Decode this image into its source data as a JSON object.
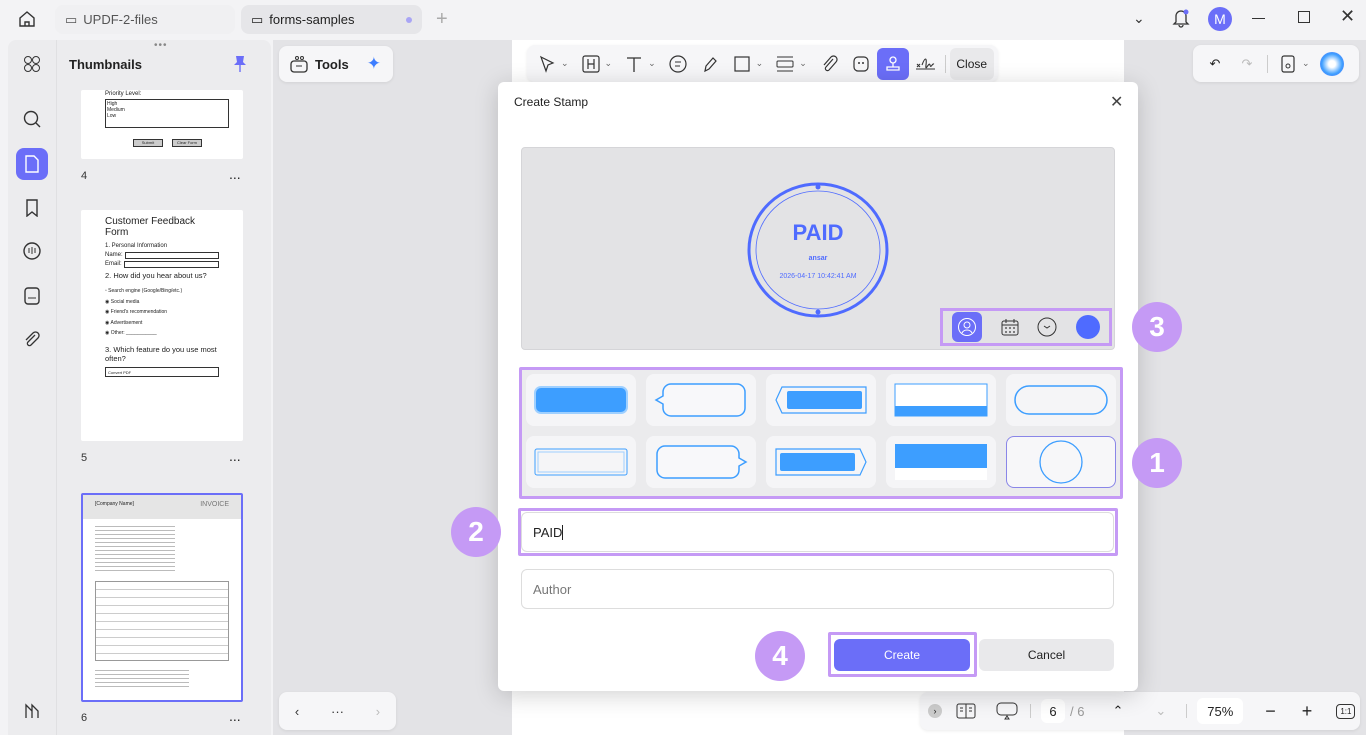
{
  "tabs": [
    {
      "label": "UPDF-2-files",
      "active": false
    },
    {
      "label": "forms-samples",
      "active": true,
      "unsaved_dot": true
    }
  ],
  "window_icons": [
    "chevron-down-icon",
    "bell-icon",
    "avatar",
    "restore-icon",
    "close-icon"
  ],
  "avatar_letter": "M",
  "thumbnails": {
    "title": "Thumbnails",
    "pages": [
      {
        "number": "4",
        "form_label": "Priority Level:",
        "options": [
          "High",
          "Medium",
          "Low"
        ],
        "buttons": [
          "Submit",
          "Clear Form"
        ]
      },
      {
        "number": "5",
        "title": "Customer Feedback Form",
        "section1": "1. Personal Information",
        "name_label": "Name:",
        "email_label": "Email:",
        "section2": "2. How did you hear about us?",
        "choices": [
          "Search engine (Google/Bing/etc.)",
          "Social media",
          "Friend's recommendation",
          "Advertisement",
          "Other: ___________"
        ],
        "section3": "3. Which feature do you use most often?",
        "select_value": "Convert PDF"
      },
      {
        "number": "6",
        "company": "[Company Name]",
        "doc_title": "INVOICE",
        "selected": true
      }
    ],
    "more": "..."
  },
  "tools": {
    "label": "Tools"
  },
  "toolbar": {
    "close_label": "Close",
    "active_tool": "stamp"
  },
  "dialog": {
    "title": "Create Stamp",
    "preview": {
      "text": "PAID",
      "author": "ansar",
      "datetime": "2026-04-17 10:42:41 AM",
      "color": "#4f6bff"
    },
    "options": [
      "user-icon",
      "calendar-icon",
      "clock-icon",
      "color-swatch"
    ],
    "stamp_styles": 10,
    "selected_style": 10,
    "text_value": "PAID",
    "author_placeholder": "Author",
    "create_label": "Create",
    "cancel_label": "Cancel",
    "step_numbers": [
      "1",
      "2",
      "3",
      "4"
    ]
  },
  "nav": {
    "current_page": "6",
    "total": "/ 6",
    "zoom": "75%",
    "fit": "1:1"
  },
  "colors": {
    "accent": "#6b6ef8",
    "highlight": "#c59af5",
    "stamp_blue": "#3d9eff"
  }
}
